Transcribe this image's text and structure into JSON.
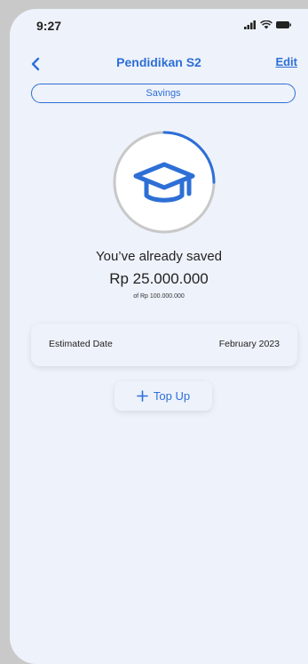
{
  "status_bar": {
    "time": "9:27",
    "icons": [
      "signal-icon",
      "wifi-icon",
      "battery-icon"
    ]
  },
  "header": {
    "title": "Pendidikan S2",
    "edit_label": "Edit",
    "back_icon": "chevron-left-icon"
  },
  "tab": {
    "label": "Savings"
  },
  "goal": {
    "icon": "graduation-cap-icon",
    "progress_fraction": 0.25,
    "saved_label": "You’ve already saved",
    "saved_amount": "Rp 25.000.000",
    "target_text": "of Rp 100.000.000"
  },
  "estimate": {
    "label": "Estimated Date",
    "value": "February 2023"
  },
  "top_up": {
    "label": "Top Up",
    "icon": "plus-icon"
  },
  "colors": {
    "accent": "#2d6fd6",
    "background": "#eef2fb",
    "ring_track": "#c8c8c8"
  }
}
